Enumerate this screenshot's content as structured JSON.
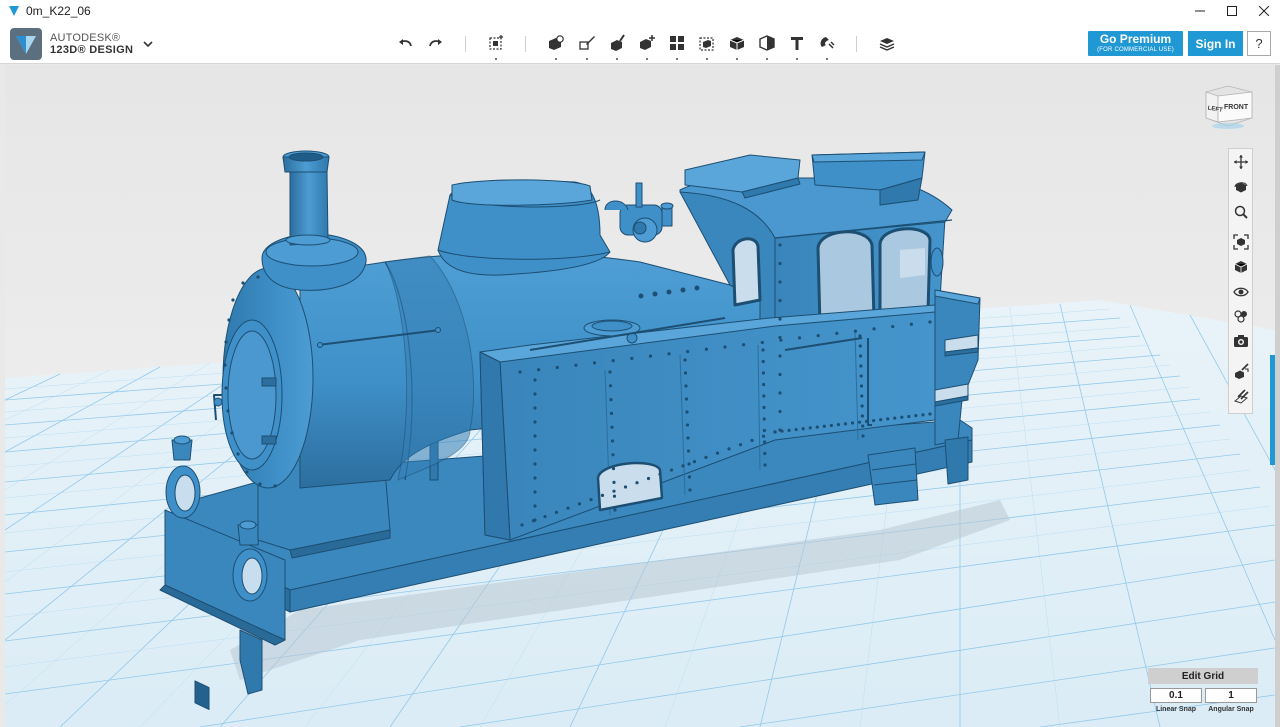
{
  "window": {
    "title": "0m_K22_06",
    "controls": {
      "minimize": "minimize-icon",
      "maximize": "maximize-icon",
      "close": "close-icon"
    }
  },
  "app": {
    "brand": "AUTODESK®",
    "product": "123D® DESIGN",
    "logo_icon": "autodesk-logo-icon",
    "menu_icon": "chevron-down-icon"
  },
  "toolbar": {
    "undo": "undo-icon",
    "redo": "redo-icon",
    "tools": [
      "transform-icon",
      "primitives-icon",
      "sketch-icon",
      "construct-icon",
      "modify-icon",
      "pattern-icon",
      "grouping-icon",
      "combine-icon",
      "measure-icon",
      "text-icon",
      "snap-icon",
      "material-icon"
    ],
    "go_premium": "Go Premium",
    "go_premium_sub": "(FOR COMMERCIAL USE)",
    "sign_in": "Sign In",
    "help": "?"
  },
  "viewcube": {
    "left_face": "LEFT",
    "front_face": "FRONT"
  },
  "nav_tools": [
    "pan-icon",
    "orbit-icon",
    "zoom-icon",
    "fit-icon",
    "view-mode-icon",
    "visibility-icon",
    "materials-outlines-icon",
    "screenshot-icon",
    "snap-tool-icon",
    "grid-settings-icon"
  ],
  "grid": {
    "edit_label": "Edit Grid",
    "linear_value": "0.1",
    "linear_label": "Linear Snap",
    "angular_value": "1",
    "angular_label": "Angular Snap"
  },
  "colors": {
    "accent": "#1f98d4",
    "model": "#3f8fc8",
    "grid_line": "#6fb7e2",
    "viewport_bg": "#e8e8e8"
  }
}
